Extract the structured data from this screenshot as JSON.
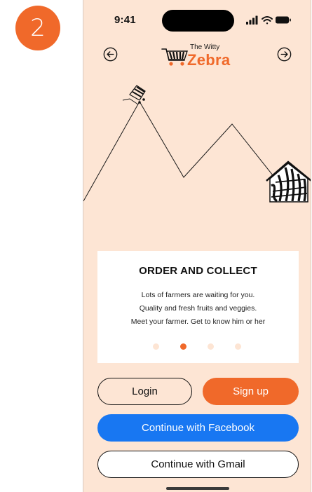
{
  "step": {
    "number": "2"
  },
  "status_bar": {
    "time": "9:41",
    "icons": [
      "signal-icon",
      "wifi-icon",
      "battery-icon"
    ]
  },
  "header": {
    "back_icon": "arrow-left-circle-icon",
    "forward_icon": "arrow-right-circle-icon",
    "logo": {
      "small_text": "The Witty",
      "big_text": "Zebra"
    }
  },
  "illustration": {
    "icons": [
      "zebra-cart-icon",
      "zebra-house-icon"
    ]
  },
  "onboarding": {
    "title": "ORDER AND COLLECT",
    "lines": [
      "Lots of farmers are waiting for you.",
      "Quality and fresh fruits and veggies.",
      "Meet your farmer. Get to know him or her"
    ],
    "page_count": 4,
    "active_page": 2
  },
  "actions": {
    "login": "Login",
    "signup": "Sign up",
    "facebook": "Continue with Facebook",
    "gmail": "Continue with Gmail"
  },
  "colors": {
    "accent": "#f0692a",
    "background": "#fde5d4",
    "facebook": "#1877f2",
    "card": "#ffffff"
  }
}
